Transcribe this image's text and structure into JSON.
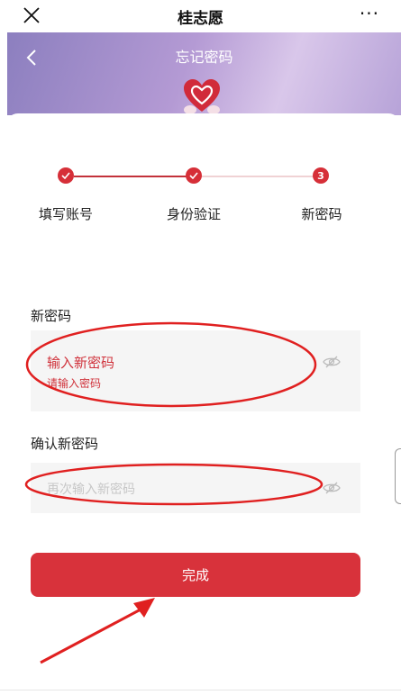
{
  "topbar": {
    "title": "桂志愿",
    "more": "···"
  },
  "banner": {
    "title": "忘记密码"
  },
  "stepper": {
    "steps": [
      {
        "label": "填写账号",
        "state": "done"
      },
      {
        "label": "身份验证",
        "state": "done"
      },
      {
        "label": "新密码",
        "state": "current",
        "number": "3"
      }
    ]
  },
  "form": {
    "new_password": {
      "label": "新密码",
      "value": "输入新密码",
      "error": "请输入密码"
    },
    "confirm_password": {
      "label": "确认新密码",
      "placeholder": "再次输入新密码"
    },
    "submit_label": "完成"
  },
  "colors": {
    "accent": "#d8323b",
    "annotation": "#e02020"
  }
}
